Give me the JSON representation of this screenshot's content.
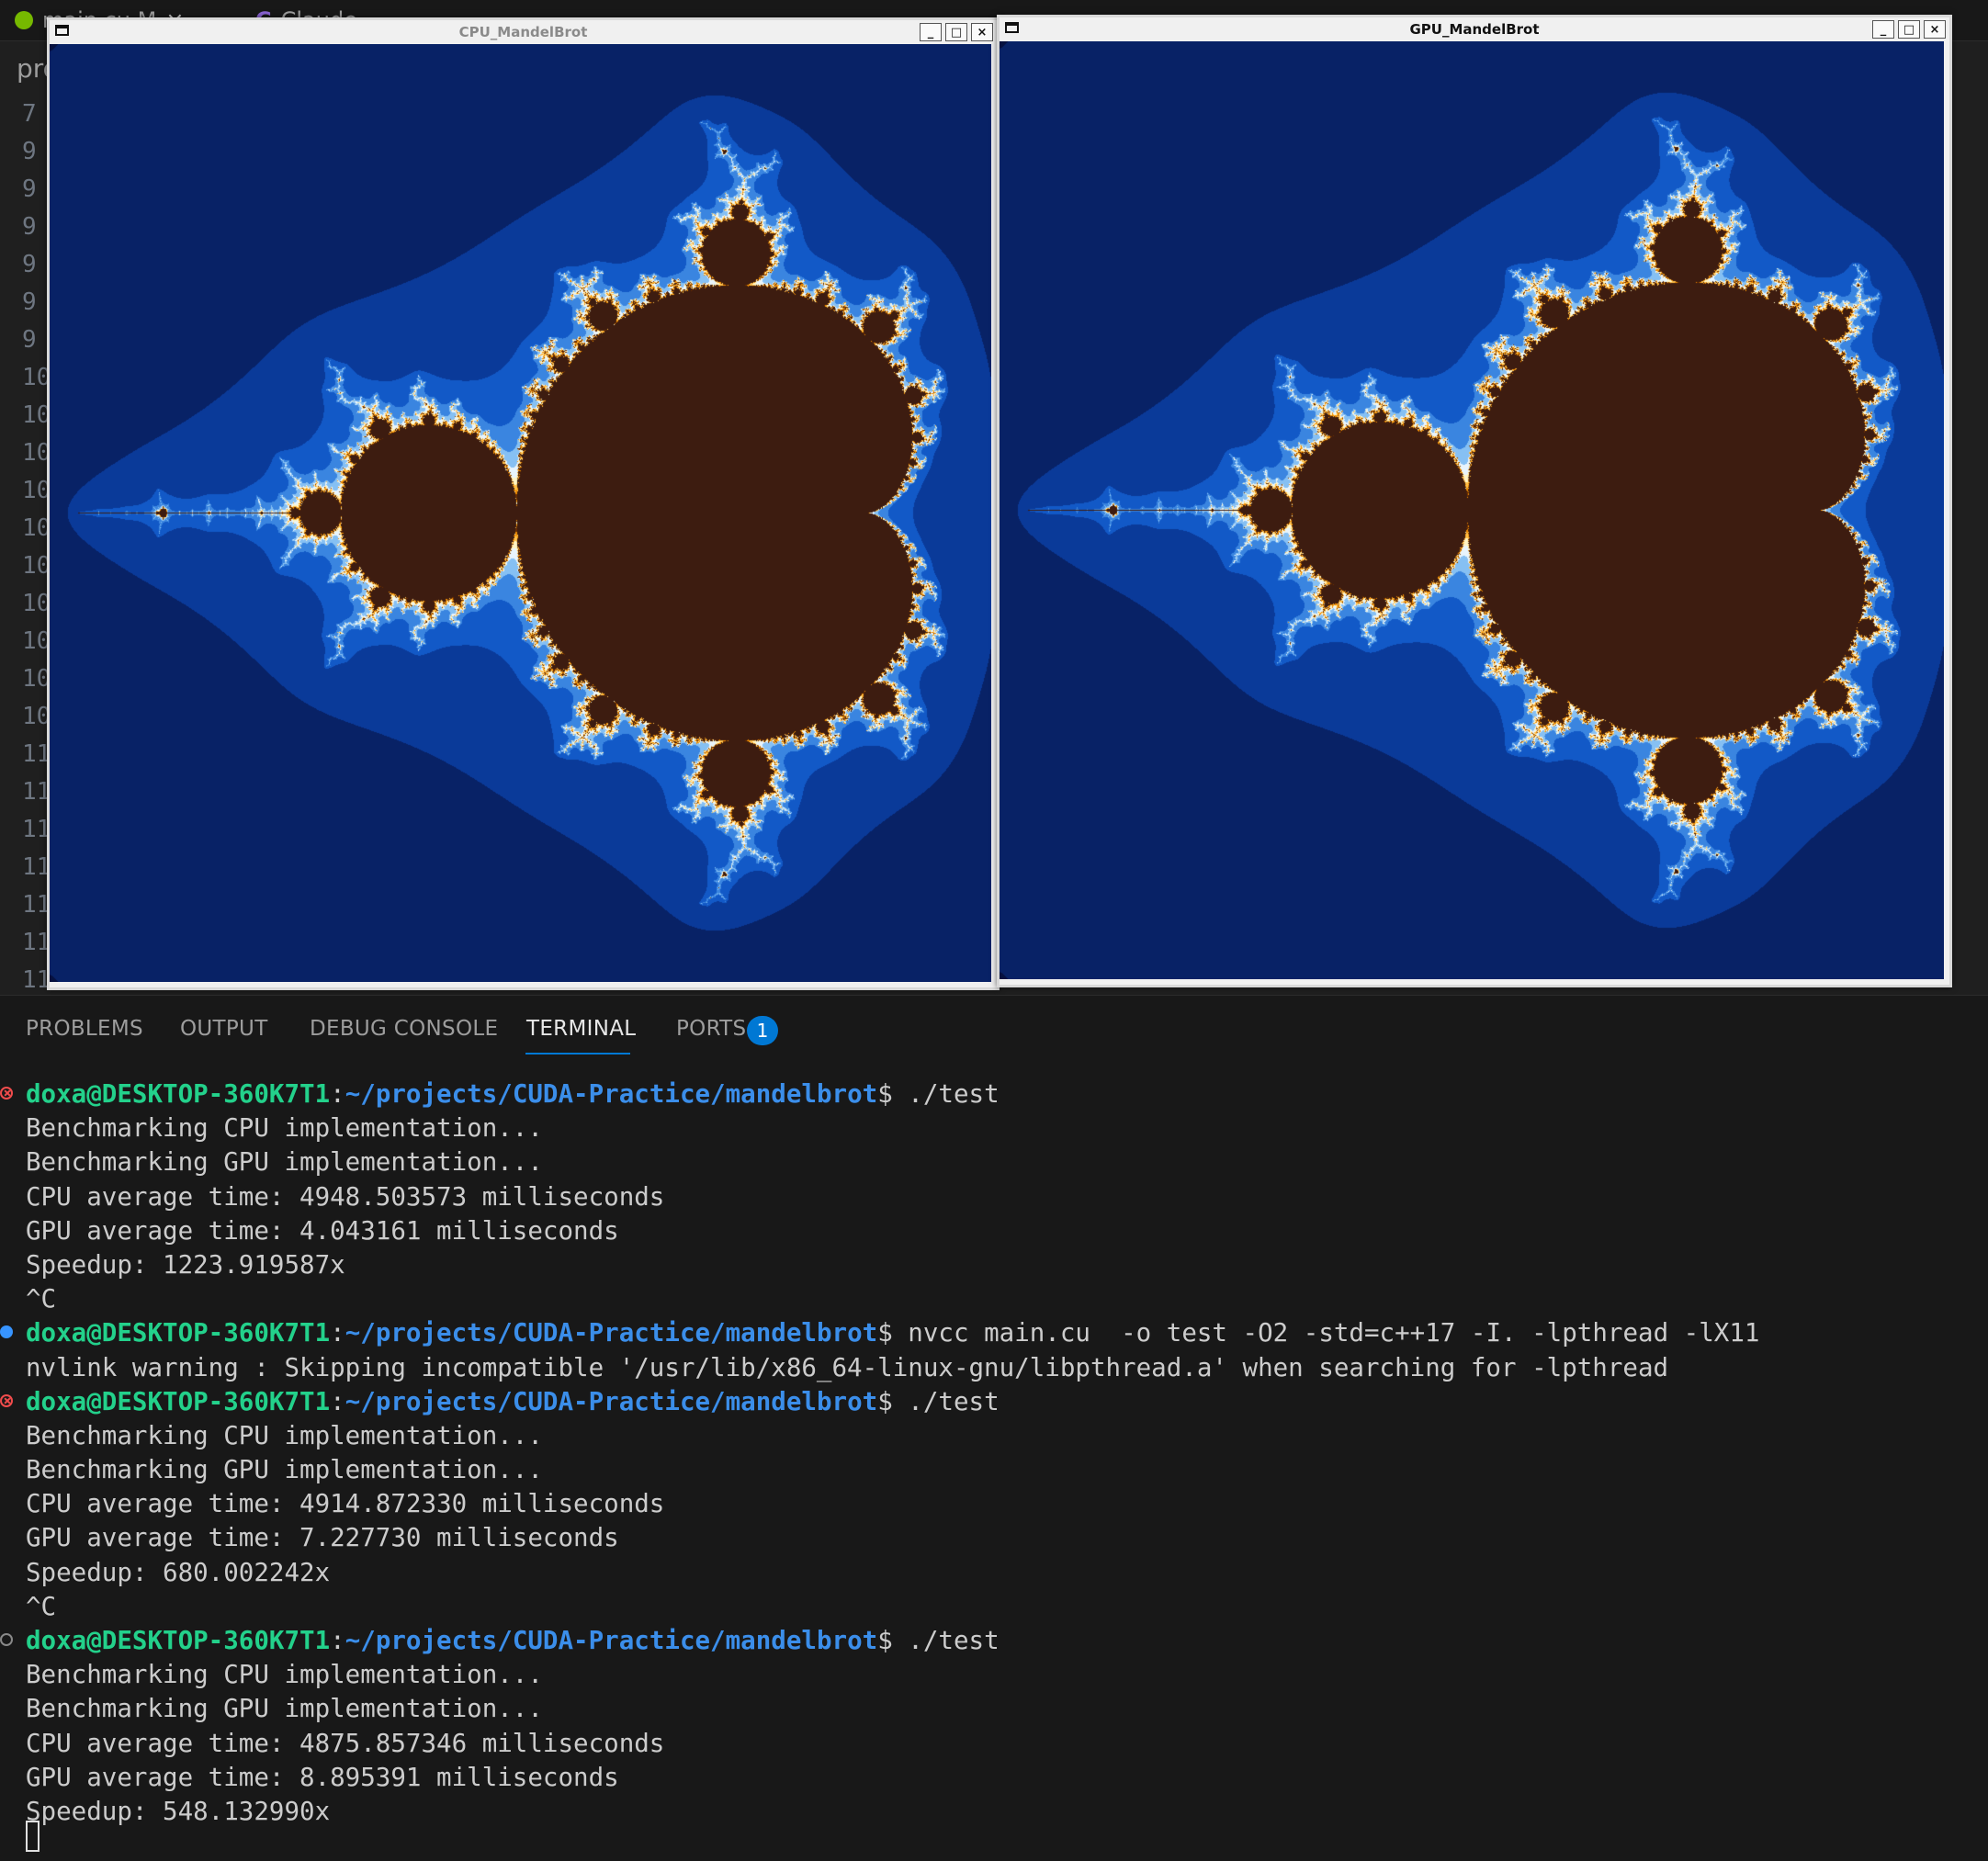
{
  "editor": {
    "tabs": [
      {
        "label": "main.cu M"
      },
      {
        "label": "Claude"
      }
    ],
    "breadcrumb": "pro",
    "line_numbers": [
      "7",
      "9",
      "9",
      "9",
      "9",
      "9",
      "9",
      "10",
      "10",
      "10",
      "10",
      "10",
      "10",
      "10",
      "10",
      "10",
      "10",
      "11",
      "11",
      "11",
      "11",
      "11",
      "11",
      "11"
    ]
  },
  "windows": {
    "cpu": {
      "title": "CPU_MandelBrot",
      "minimize": "_",
      "maximize": "□",
      "close": "×"
    },
    "gpu": {
      "title": "GPU_MandelBrot",
      "minimize": "_",
      "maximize": "□",
      "close": "×"
    }
  },
  "fractal_colors": {
    "set_interior": "#3d1c10",
    "gradient": [
      "#1a0b1e",
      "#06113f",
      "#082266",
      "#0a3a99",
      "#1259c7",
      "#3a85e0",
      "#86c0f3",
      "#e8f4fc",
      "#fff4c4",
      "#ffc04a",
      "#f08c00",
      "#6a2d00"
    ]
  },
  "panel": {
    "tabs": [
      {
        "label": "PROBLEMS"
      },
      {
        "label": "OUTPUT"
      },
      {
        "label": "DEBUG CONSOLE"
      },
      {
        "label": "TERMINAL"
      },
      {
        "label": "PORTS"
      }
    ],
    "active_tab": "TERMINAL",
    "ports_badge": "1"
  },
  "terminal": {
    "lines": [
      {
        "kind": "prompt",
        "decoration": "error",
        "user": "doxa@DESKTOP-360K7T1",
        "colon": ":",
        "path": "~/projects/CUDA-Practice/mandelbrot",
        "cmd": "$ ./test"
      },
      {
        "kind": "out",
        "text": "Benchmarking CPU implementation..."
      },
      {
        "kind": "out",
        "text": "Benchmarking GPU implementation..."
      },
      {
        "kind": "out",
        "text": "CPU average time: 4948.503573 milliseconds"
      },
      {
        "kind": "out",
        "text": "GPU average time: 4.043161 milliseconds"
      },
      {
        "kind": "out",
        "text": "Speedup: 1223.919587x"
      },
      {
        "kind": "out",
        "text": "^C"
      },
      {
        "kind": "prompt",
        "decoration": "success",
        "user": "doxa@DESKTOP-360K7T1",
        "colon": ":",
        "path": "~/projects/CUDA-Practice/mandelbrot",
        "cmd": "$ nvcc main.cu  -o test -O2 -std=c++17 -I. -lpthread -lX11"
      },
      {
        "kind": "out",
        "text": "nvlink warning : Skipping incompatible '/usr/lib/x86_64-linux-gnu/libpthread.a' when searching for -lpthread"
      },
      {
        "kind": "prompt",
        "decoration": "error",
        "user": "doxa@DESKTOP-360K7T1",
        "colon": ":",
        "path": "~/projects/CUDA-Practice/mandelbrot",
        "cmd": "$ ./test"
      },
      {
        "kind": "out",
        "text": "Benchmarking CPU implementation..."
      },
      {
        "kind": "out",
        "text": "Benchmarking GPU implementation..."
      },
      {
        "kind": "out",
        "text": "CPU average time: 4914.872330 milliseconds"
      },
      {
        "kind": "out",
        "text": "GPU average time: 7.227730 milliseconds"
      },
      {
        "kind": "out",
        "text": "Speedup: 680.002242x"
      },
      {
        "kind": "out",
        "text": "^C"
      },
      {
        "kind": "prompt",
        "decoration": "default",
        "user": "doxa@DESKTOP-360K7T1",
        "colon": ":",
        "path": "~/projects/CUDA-Practice/mandelbrot",
        "cmd": "$ ./test"
      },
      {
        "kind": "out",
        "text": "Benchmarking CPU implementation..."
      },
      {
        "kind": "out",
        "text": "Benchmarking GPU implementation..."
      },
      {
        "kind": "out",
        "text": "CPU average time: 4875.857346 milliseconds"
      },
      {
        "kind": "out",
        "text": "GPU average time: 8.895391 milliseconds"
      },
      {
        "kind": "out",
        "text": "Speedup: 548.132990x"
      }
    ]
  }
}
